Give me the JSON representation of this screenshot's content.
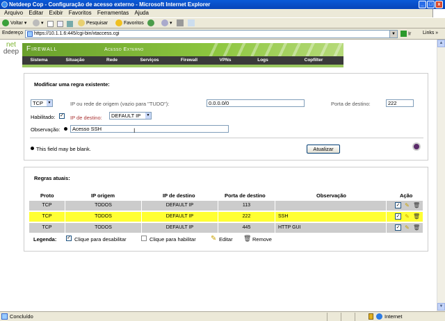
{
  "window": {
    "title": "Netdeep Cop - Configuração de acesso externo - Microsoft Internet Explorer"
  },
  "menu": [
    "Arquivo",
    "Editar",
    "Exibir",
    "Favoritos",
    "Ferramentas",
    "Ajuda"
  ],
  "toolbar": {
    "back": "Voltar",
    "search": "Pesquisar",
    "favorites": "Favoritos"
  },
  "address": {
    "label": "Endereço",
    "url": "https://10.1.1.6:445/cgi-bin/xtaccess.cgi",
    "go": "Ir",
    "links": "Links"
  },
  "logo": {
    "line1": "net",
    "line2": "deep"
  },
  "banner": {
    "title": "Firewall",
    "subtitle": "Acesso Externo"
  },
  "nav": [
    "Sistema",
    "Situação",
    "Rede",
    "Serviços",
    "Firewall",
    "VPNs",
    "Logs",
    "Copfilter"
  ],
  "form": {
    "title": "Modificar uma regra existente:",
    "proto": "TCP",
    "source_label": "IP ou rede de origem (vazio para \"TUDO\"):",
    "source_value": "0.0.0.0/0",
    "port_label": "Porta de destino:",
    "port_value": "222",
    "enabled_label": "Habilitado:",
    "dest_label": "IP de destino:",
    "dest_value": "DEFAULT IP",
    "note_label": "Observação:",
    "note_value": "Acesso SSH",
    "blank_note": "This field may be blank.",
    "update_button": "Atualizar"
  },
  "rules": {
    "title": "Regras atuais:",
    "headers": [
      "Proto",
      "IP origem",
      "IP de destino",
      "Porta de destino",
      "Observação",
      "Ação"
    ],
    "rows": [
      {
        "proto": "TCP",
        "src": "TODOS",
        "dst": "DEFAULT IP",
        "port": "113",
        "note": "",
        "highlight": false
      },
      {
        "proto": "TCP",
        "src": "TODOS",
        "dst": "DEFAULT IP",
        "port": "222",
        "note": "SSH",
        "highlight": true
      },
      {
        "proto": "TCP",
        "src": "TODOS",
        "dst": "DEFAULT IP",
        "port": "445",
        "note": "HTTP GUI",
        "highlight": false
      }
    ],
    "legend_label": "Legenda:",
    "legend_disable": "Clique para desabilitar",
    "legend_enable": "Clique para habilitar",
    "legend_edit": "Editar",
    "legend_remove": "Remove"
  },
  "status": {
    "text": "Concluído",
    "zone": "Internet"
  },
  "colors": {
    "brand_green": "#8dc63f",
    "nav_bg": "#3a3a3a",
    "highlight_row": "#ffff33",
    "row_gray": "#cccccc"
  }
}
